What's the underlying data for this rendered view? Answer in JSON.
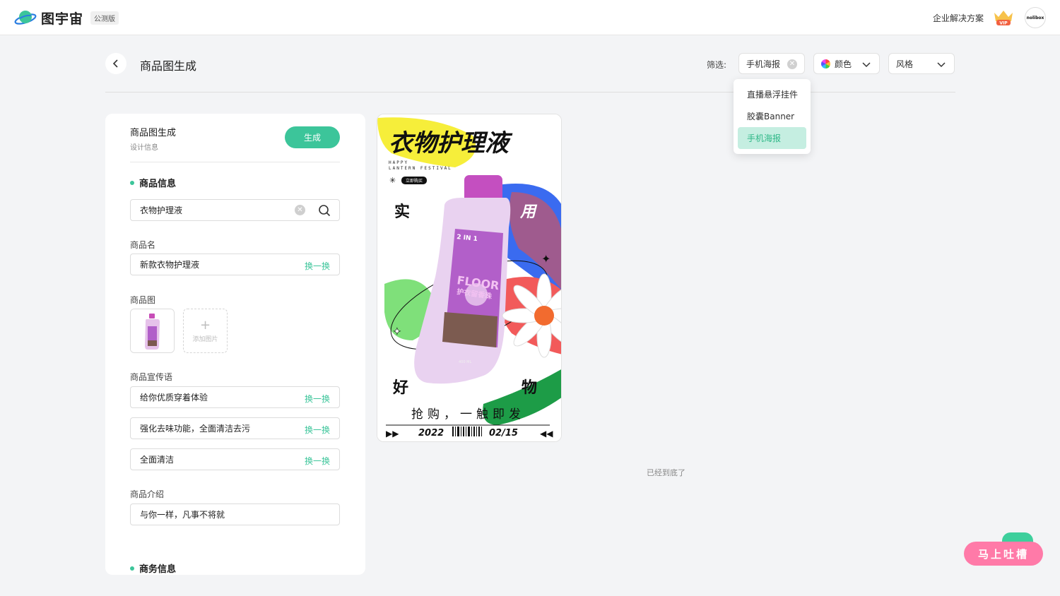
{
  "header": {
    "app_name": "图宇宙",
    "beta_badge": "公测版",
    "enterprise_link": "企业解决方案",
    "vip_label": "VIP",
    "avatar_text": "nolibox"
  },
  "page": {
    "title": "商品图生成",
    "filter_label": "筛选:",
    "filters": {
      "type_value": "手机海报",
      "color_label": "颜色",
      "style_label": "风格"
    },
    "dropdown_options": [
      "直播悬浮挂件",
      "胶囊Banner",
      "手机海报"
    ],
    "dropdown_selected": "手机海报",
    "bottom_note": "已经到底了"
  },
  "panel": {
    "title": "商品图生成",
    "subtitle": "设计信息",
    "generate_button": "生成",
    "section_product": "商品信息",
    "search_value": "衣物护理液",
    "name_label": "商品名",
    "name_value": "新款衣物护理液",
    "swap_label": "换一换",
    "image_label": "商品图",
    "add_image_label": "添加图片",
    "slogan_label": "商品宣传语",
    "slogans": [
      "给你优质穿着体验",
      "强化去味功能，全面清洁去污",
      "全面清洁"
    ],
    "intro_label": "商品介绍",
    "intro_value": "与你一样，凡事不将就",
    "section_business": "商务信息"
  },
  "poster": {
    "headline": "衣物护理液",
    "sub1": "HAPPY",
    "sub2": "LANTERN FESTIVAL",
    "buy_tag": "立即购买",
    "word_tl": "实",
    "word_tr": "用",
    "word_bl": "好",
    "word_br": "物",
    "bottle_tag": "2 IN 1",
    "bottle_brand": "FLOOR",
    "bottle_cn": "护衣留香珠",
    "bottle_volume": "400 ML",
    "cta": "抢购，一触即发",
    "year": "2022",
    "date": "02/15"
  },
  "feedback": {
    "label": "马上吐槽"
  },
  "colors": {
    "accent": "#3cc59a",
    "feedback": "#ff7aa8"
  }
}
